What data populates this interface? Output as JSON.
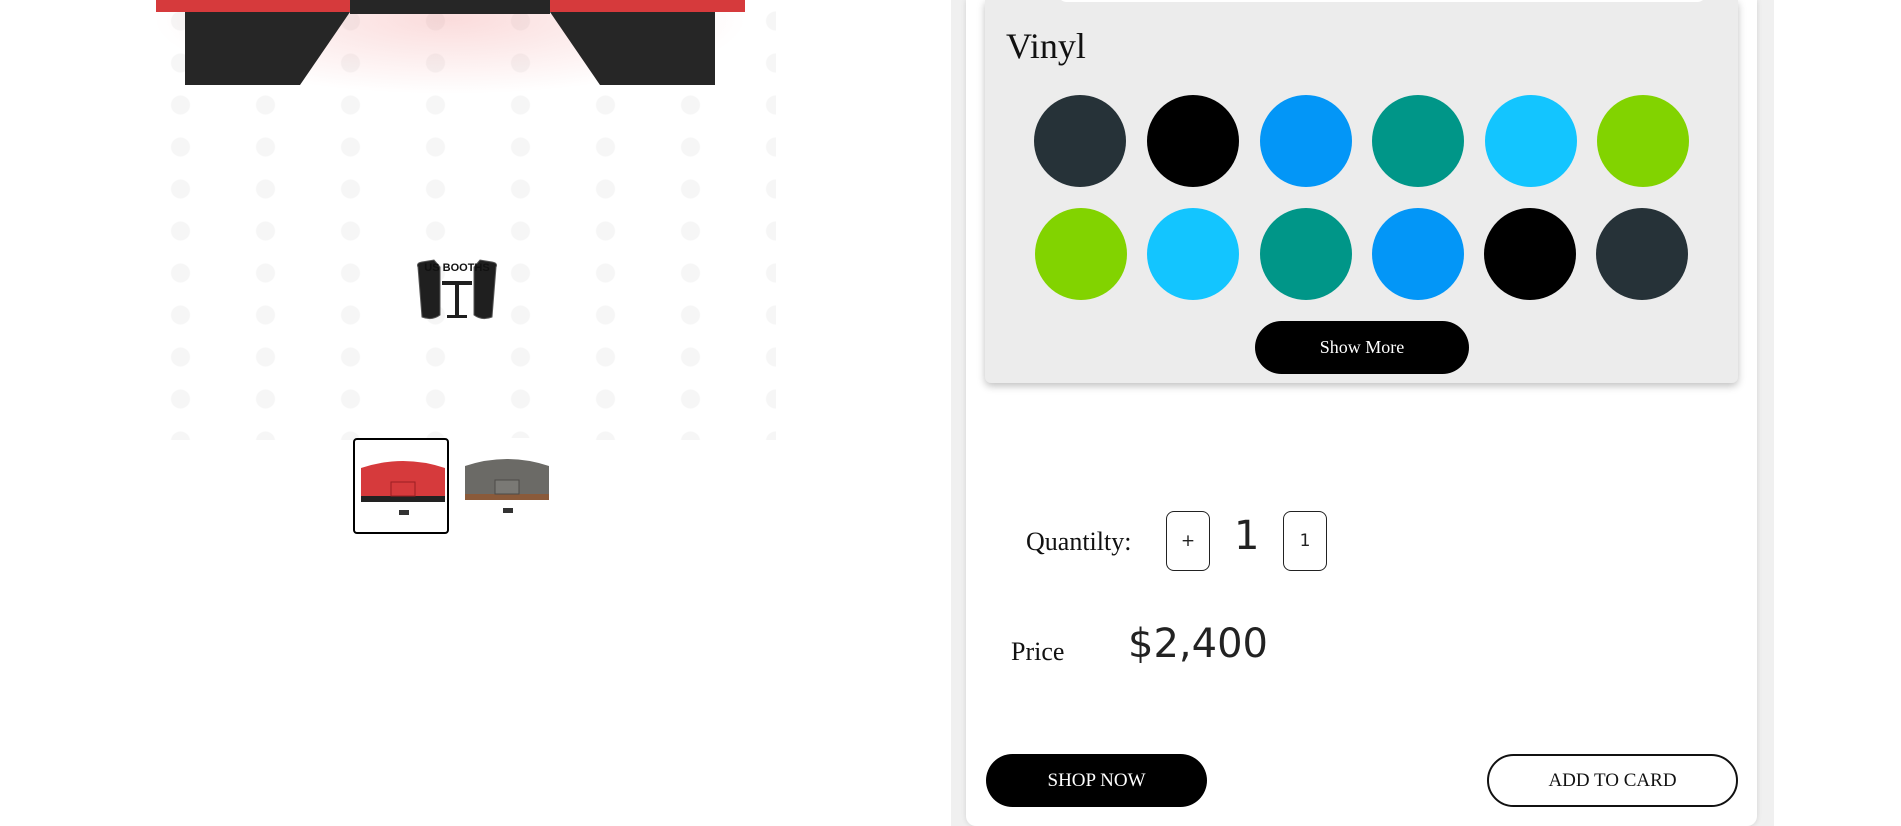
{
  "gallery": {
    "logo_text": "US BOOTHS",
    "thumbnails": [
      {
        "name": "red-booth-thumbnail",
        "active": true
      },
      {
        "name": "gray-booth-thumbnail",
        "active": false
      }
    ]
  },
  "colors": {
    "section_title": "Vinyl",
    "swatches": [
      [
        "#263238",
        "#000000",
        "#0396f7",
        "#009688",
        "#13c5ff",
        "#82d300"
      ],
      [
        "#82d300",
        "#13c5ff",
        "#009688",
        "#0396f7",
        "#000000",
        "#263238"
      ]
    ],
    "show_more_label": "Show More"
  },
  "quantity": {
    "label": "Quantilty:",
    "increment_label": "+",
    "value": "1",
    "decrement_label": "1"
  },
  "price": {
    "label": "Price",
    "value": "$2,400"
  },
  "actions": {
    "shop_now_label": "SHOP NOW",
    "add_to_card_label": "ADD TO CARD"
  }
}
